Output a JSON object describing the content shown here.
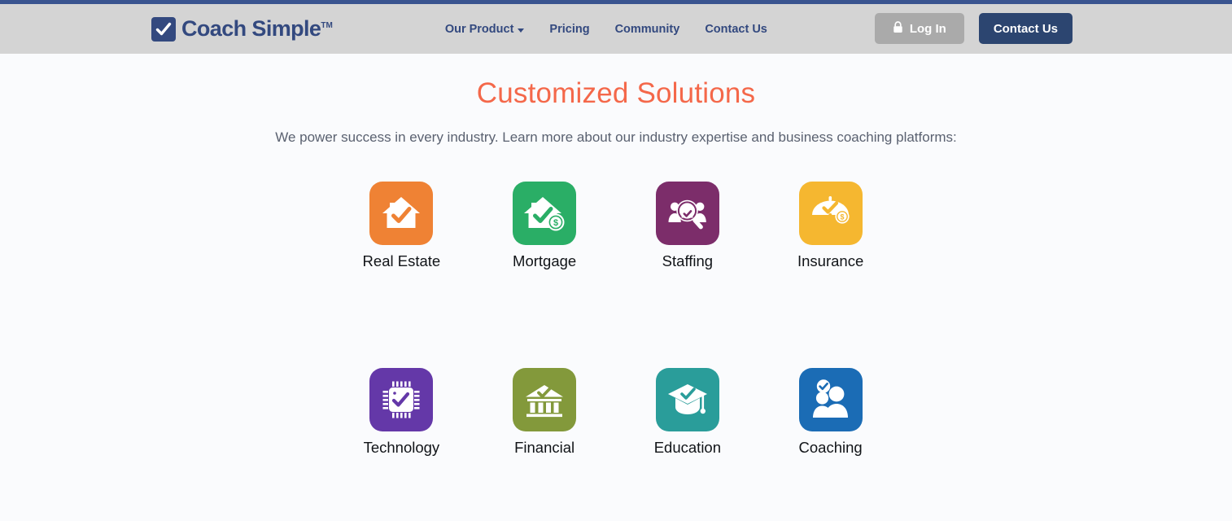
{
  "theme": {
    "top_strip_color": "#39548f",
    "header_bg": "#d4d4d4",
    "body_bg": "#fafbfd",
    "brand_color": "#33497f",
    "heading_color": "#f4684a",
    "subtitle_color": "#5a6170",
    "login_button_bg": "#aaaaaa",
    "contact_button_bg": "#2c4570"
  },
  "header": {
    "brand": {
      "name": "Coach Simple",
      "trademark": "TM",
      "logo_icon": "checkbox-check-icon"
    },
    "nav": [
      {
        "label": "Our Product",
        "has_dropdown": true,
        "icon": "chevron-down-icon"
      },
      {
        "label": "Pricing",
        "has_dropdown": false
      },
      {
        "label": "Community",
        "has_dropdown": false
      },
      {
        "label": "Contact Us",
        "has_dropdown": false
      }
    ],
    "actions": {
      "login_label": "Log In",
      "login_icon": "lock-icon",
      "contact_label": "Contact Us"
    }
  },
  "main": {
    "title": "Customized Solutions",
    "subtitle": "We power success in every industry. Learn more about our industry expertise and business coaching platforms:",
    "industries": [
      {
        "label": "Real Estate",
        "icon": "house-check-icon",
        "color": "#ef8234"
      },
      {
        "label": "Mortgage",
        "icon": "house-check-dollar-icon",
        "color": "#2aae66"
      },
      {
        "label": "Staffing",
        "icon": "people-magnifier-icon",
        "color": "#7c2d6a"
      },
      {
        "label": "Insurance",
        "icon": "umbrella-check-dollar-icon",
        "color": "#f5b730"
      },
      {
        "label": "Technology",
        "icon": "cpu-chip-check-icon",
        "color": "#6438a8"
      },
      {
        "label": "Financial",
        "icon": "bank-check-icon",
        "color": "#83993b"
      },
      {
        "label": "Education",
        "icon": "graduation-cap-check-icon",
        "color": "#2a9d9a"
      },
      {
        "label": "Coaching",
        "icon": "people-check-icon",
        "color": "#1b6cb5"
      }
    ]
  }
}
